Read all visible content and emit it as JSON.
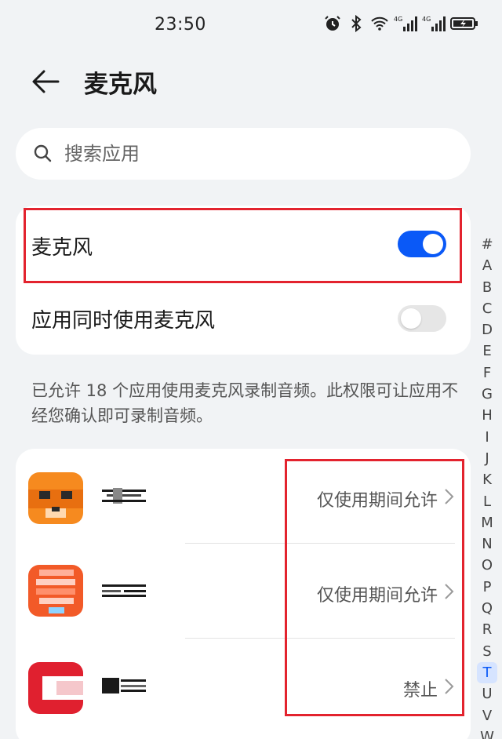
{
  "status_bar": {
    "time": "23:50",
    "icons": [
      "alarm-icon",
      "bluetooth-icon",
      "wifi-icon",
      "signal-4g-icon",
      "signal-4g-icon",
      "battery-icon"
    ],
    "signal_label": "4G"
  },
  "header": {
    "title": "麦克风",
    "back_icon": "arrow-left-icon"
  },
  "search": {
    "placeholder": "搜索应用"
  },
  "settings": {
    "microphone": {
      "label": "麦克风",
      "enabled": true
    },
    "simultaneous": {
      "label": "应用同时使用麦克风",
      "enabled": false
    }
  },
  "description": "已允许 18 个应用使用麦克风录制音频。此权限可让应用不经您确认即可录制音频。",
  "apps": [
    {
      "status": "仅使用期间允许"
    },
    {
      "status": "仅使用期间允许"
    },
    {
      "status": "禁止"
    }
  ],
  "alpha_index": [
    "#",
    "A",
    "B",
    "C",
    "D",
    "E",
    "F",
    "G",
    "H",
    "I",
    "J",
    "K",
    "L",
    "M",
    "N",
    "O",
    "P",
    "Q",
    "R",
    "S",
    "T",
    "U",
    "V",
    "W"
  ],
  "alpha_active": "T",
  "colors": {
    "accent": "#0a59f7",
    "highlight_box": "#e3232e"
  }
}
